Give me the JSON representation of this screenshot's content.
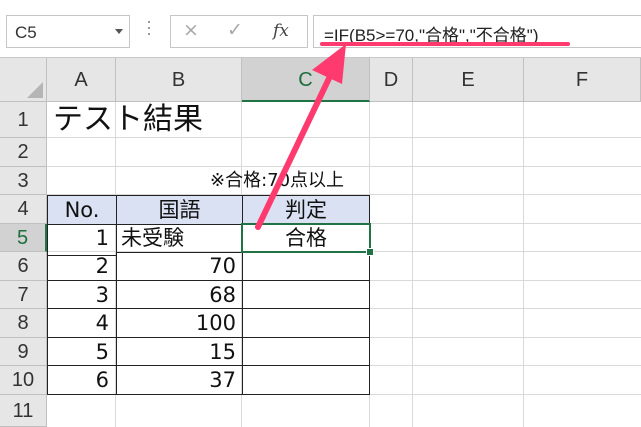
{
  "formula_bar": {
    "name_box": "C5",
    "cancel_icon": "×",
    "enter_icon": "✓",
    "fx_label": "fx",
    "formula": "=IF(B5>=70,\"合格\",\"不合格\")"
  },
  "columns": [
    "A",
    "B",
    "C",
    "D",
    "E",
    "F"
  ],
  "rows": [
    "1",
    "2",
    "3",
    "4",
    "5",
    "6",
    "7",
    "8",
    "9",
    "10",
    "11"
  ],
  "sheet": {
    "title": "テスト結果",
    "note": "※合格:70点以上",
    "headers": {
      "no": "No.",
      "subject": "国語",
      "result": "判定"
    },
    "records": [
      {
        "no": "1",
        "score": "未受験",
        "result": "合格"
      },
      {
        "no": "2",
        "score": "70",
        "result": ""
      },
      {
        "no": "3",
        "score": "68",
        "result": ""
      },
      {
        "no": "4",
        "score": "100",
        "result": ""
      },
      {
        "no": "5",
        "score": "15",
        "result": ""
      },
      {
        "no": "6",
        "score": "37",
        "result": ""
      }
    ]
  },
  "selection": {
    "active_cell": "C5"
  },
  "colors": {
    "accent_green": "#217346",
    "header_fill": "#d9e1f2",
    "annotation_pink": "#ff3a6e"
  }
}
